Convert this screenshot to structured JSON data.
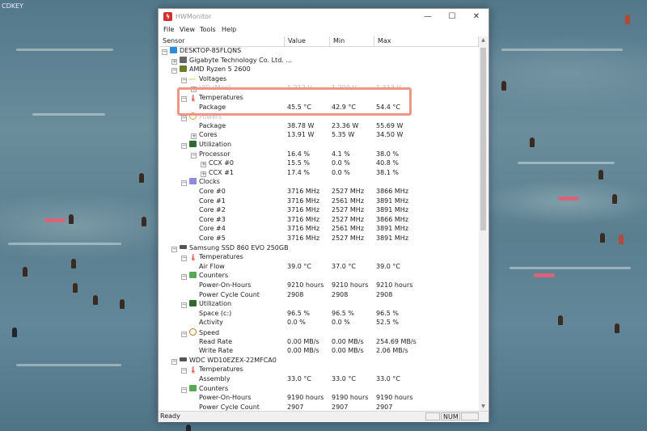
{
  "desktop": {
    "corner_text": "CDKEY"
  },
  "window": {
    "title": "HWMonitor",
    "menu": [
      "File",
      "View",
      "Tools",
      "Help"
    ],
    "controls": {
      "minimize": "—",
      "maximize": "☐",
      "close": "✕"
    }
  },
  "columns": [
    "Sensor",
    "Value",
    "Min",
    "Max"
  ],
  "rows": [
    {
      "label": "DESKTOP-85FLQNS",
      "icon": "pc",
      "exp": "−",
      "value": "",
      "min": "",
      "max": ""
    },
    {
      "label": "Gigabyte Technology Co. Ltd. ...",
      "icon": "mb",
      "exp": "+",
      "value": "",
      "min": "",
      "max": ""
    },
    {
      "label": "AMD Ryzen 5 2600",
      "icon": "cpu",
      "exp": "−",
      "value": "",
      "min": "",
      "max": ""
    },
    {
      "label": "Voltages",
      "icon": "volt",
      "exp": "−",
      "value": "",
      "min": "",
      "max": ""
    },
    {
      "label": "VID (Max)",
      "icon": "",
      "exp": "+",
      "value": "1.212 V",
      "min": "1.200 V",
      "max": "1.313 V",
      "faded": true
    },
    {
      "label": "Temperatures",
      "icon": "temp",
      "exp": "−",
      "value": "",
      "min": "",
      "max": ""
    },
    {
      "label": "Package",
      "icon": "",
      "exp": "",
      "value": "45.5 °C",
      "min": "42.9 °C",
      "max": "54.4 °C"
    },
    {
      "label": "Powers",
      "icon": "power",
      "exp": "−",
      "value": "",
      "min": "",
      "max": "",
      "faded": true
    },
    {
      "label": "Package",
      "icon": "",
      "exp": "",
      "value": "38.78 W",
      "min": "23.36 W",
      "max": "55.69 W"
    },
    {
      "label": "Cores",
      "icon": "",
      "exp": "+",
      "value": "13.91 W",
      "min": "5.35 W",
      "max": "34.50 W"
    },
    {
      "label": "Utilization",
      "icon": "util",
      "exp": "−",
      "value": "",
      "min": "",
      "max": ""
    },
    {
      "label": "Processor",
      "icon": "",
      "exp": "−",
      "value": "16.4 %",
      "min": "4.1 %",
      "max": "38.0 %"
    },
    {
      "label": "CCX #0",
      "icon": "",
      "exp": "+",
      "value": "15.5 %",
      "min": "0.0 %",
      "max": "40.8 %"
    },
    {
      "label": "CCX #1",
      "icon": "",
      "exp": "+",
      "value": "17.4 %",
      "min": "0.0 %",
      "max": "38.1 %"
    },
    {
      "label": "Clocks",
      "icon": "clock",
      "exp": "−",
      "value": "",
      "min": "",
      "max": ""
    },
    {
      "label": "Core #0",
      "icon": "",
      "exp": "",
      "value": "3716 MHz",
      "min": "2527 MHz",
      "max": "3866 MHz"
    },
    {
      "label": "Core #1",
      "icon": "",
      "exp": "",
      "value": "3716 MHz",
      "min": "2561 MHz",
      "max": "3891 MHz"
    },
    {
      "label": "Core #2",
      "icon": "",
      "exp": "",
      "value": "3716 MHz",
      "min": "2527 MHz",
      "max": "3891 MHz"
    },
    {
      "label": "Core #3",
      "icon": "",
      "exp": "",
      "value": "3716 MHz",
      "min": "2527 MHz",
      "max": "3866 MHz"
    },
    {
      "label": "Core #4",
      "icon": "",
      "exp": "",
      "value": "3716 MHz",
      "min": "2561 MHz",
      "max": "3891 MHz"
    },
    {
      "label": "Core #5",
      "icon": "",
      "exp": "",
      "value": "3716 MHz",
      "min": "2527 MHz",
      "max": "3891 MHz"
    },
    {
      "label": "Samsung SSD 860 EVO 250GB",
      "icon": "disk",
      "exp": "−",
      "value": "",
      "min": "",
      "max": ""
    },
    {
      "label": "Temperatures",
      "icon": "temp",
      "exp": "−",
      "value": "",
      "min": "",
      "max": ""
    },
    {
      "label": "Air Flow",
      "icon": "",
      "exp": "",
      "value": "39.0 °C",
      "min": "37.0 °C",
      "max": "39.0 °C"
    },
    {
      "label": "Counters",
      "icon": "counter",
      "exp": "−",
      "value": "",
      "min": "",
      "max": ""
    },
    {
      "label": "Power-On-Hours",
      "icon": "",
      "exp": "",
      "value": "9210 hours",
      "min": "9210 hours",
      "max": "9210 hours"
    },
    {
      "label": "Power Cycle Count",
      "icon": "",
      "exp": "",
      "value": "2908",
      "min": "2908",
      "max": "2908"
    },
    {
      "label": "Utilization",
      "icon": "util",
      "exp": "−",
      "value": "",
      "min": "",
      "max": ""
    },
    {
      "label": "Space (c:)",
      "icon": "",
      "exp": "",
      "value": "96.5 %",
      "min": "96.5 %",
      "max": "96.5 %"
    },
    {
      "label": "Activity",
      "icon": "",
      "exp": "",
      "value": "0.0 %",
      "min": "0.0 %",
      "max": "52.5 %"
    },
    {
      "label": "Speed",
      "icon": "speed",
      "exp": "−",
      "value": "",
      "min": "",
      "max": ""
    },
    {
      "label": "Read Rate",
      "icon": "",
      "exp": "",
      "value": "0.00 MB/s",
      "min": "0.00 MB/s",
      "max": "254.69 MB/s"
    },
    {
      "label": "Write Rate",
      "icon": "",
      "exp": "",
      "value": "0.00 MB/s",
      "min": "0.00 MB/s",
      "max": "2.06 MB/s"
    },
    {
      "label": "WDC WD10EZEX-22MFCA0",
      "icon": "disk",
      "exp": "−",
      "value": "",
      "min": "",
      "max": ""
    },
    {
      "label": "Temperatures",
      "icon": "temp",
      "exp": "−",
      "value": "",
      "min": "",
      "max": ""
    },
    {
      "label": "Assembly",
      "icon": "",
      "exp": "",
      "value": "33.0 °C",
      "min": "33.0 °C",
      "max": "33.0 °C"
    },
    {
      "label": "Counters",
      "icon": "counter",
      "exp": "−",
      "value": "",
      "min": "",
      "max": ""
    },
    {
      "label": "Power-On-Hours",
      "icon": "",
      "exp": "",
      "value": "9190 hours",
      "min": "9190 hours",
      "max": "9190 hours"
    },
    {
      "label": "Power Cycle Count",
      "icon": "",
      "exp": "",
      "value": "2907",
      "min": "2907",
      "max": "2907"
    }
  ],
  "indent_levels": [
    0,
    1,
    1,
    2,
    3,
    2,
    3,
    2,
    3,
    3,
    2,
    3,
    4,
    4,
    2,
    3,
    3,
    3,
    3,
    3,
    3,
    1,
    2,
    3,
    2,
    3,
    3,
    2,
    3,
    3,
    2,
    3,
    3,
    1,
    2,
    3,
    2,
    3,
    3
  ],
  "status": {
    "text": "Ready",
    "num": "NUM"
  },
  "scrollbar": {
    "up": "▲",
    "down": "▼"
  },
  "colors": {
    "highlight": "#f0958a",
    "accent_red": "#d23030"
  }
}
